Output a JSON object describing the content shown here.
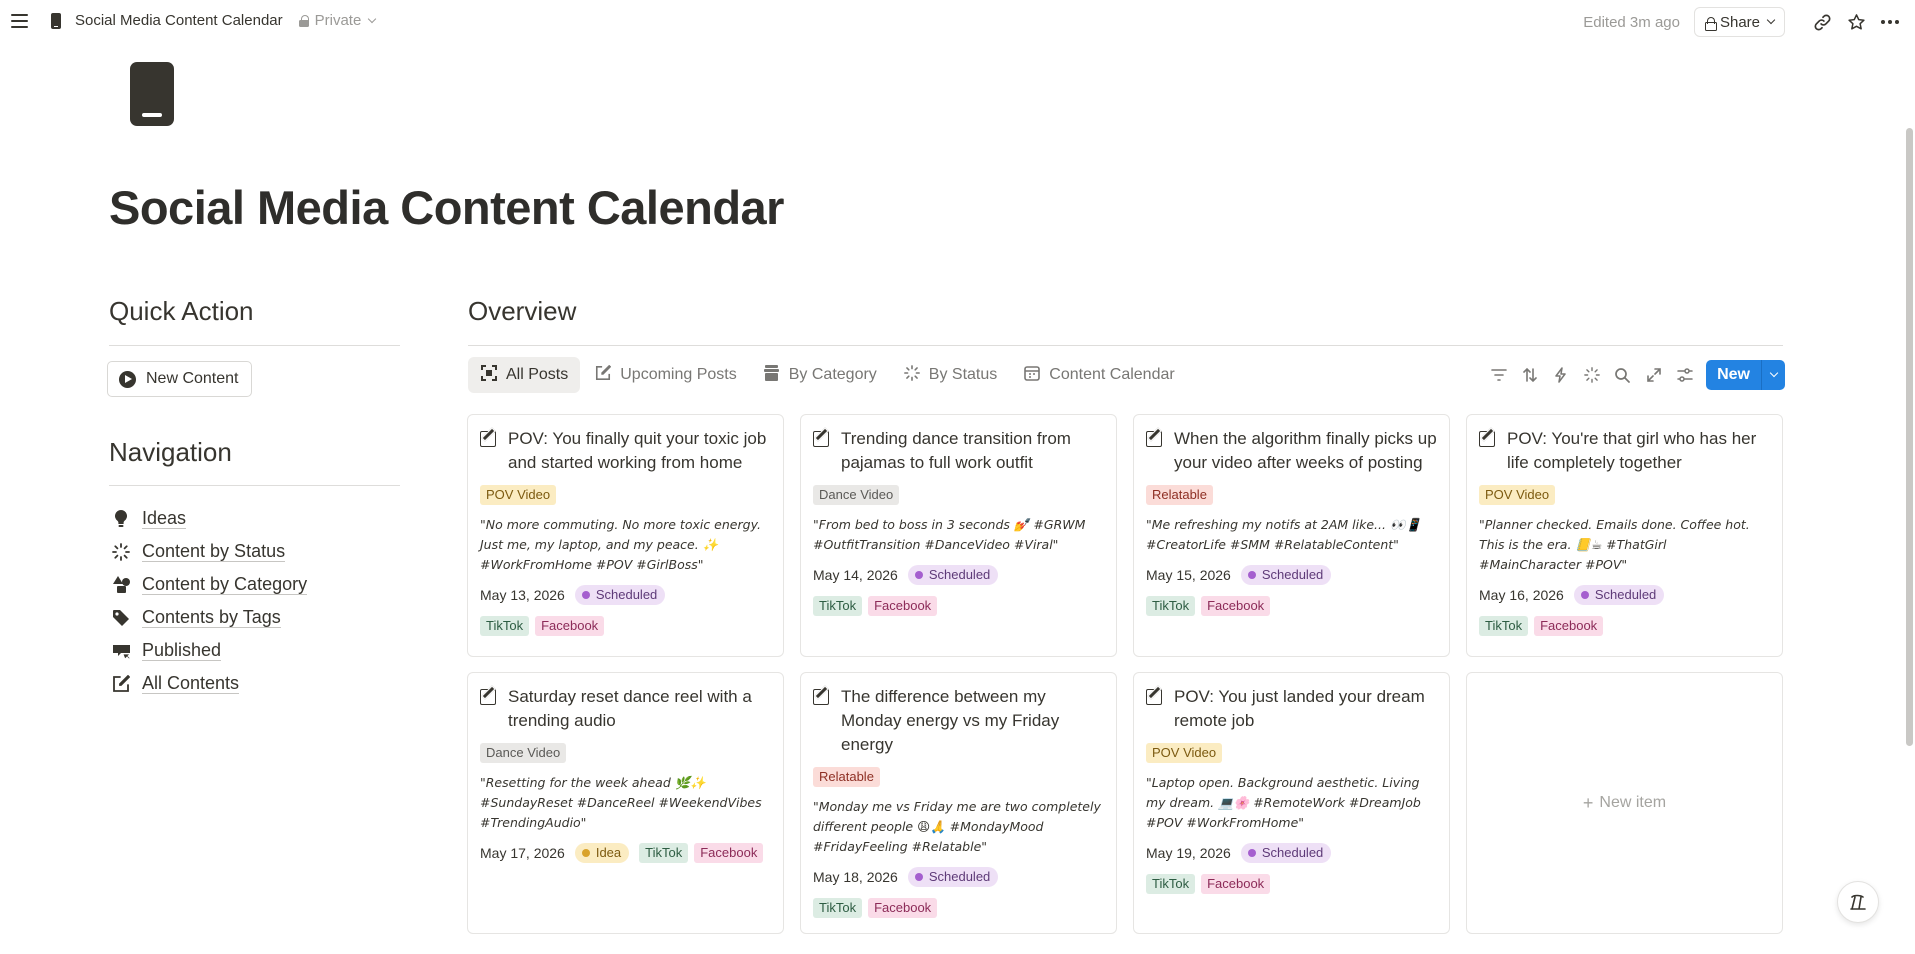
{
  "topbar": {
    "page_name": "Social Media Content Calendar",
    "visibility": "Private",
    "edited": "Edited 3m ago",
    "share_label": "Share"
  },
  "page": {
    "title": "Social Media Content Calendar"
  },
  "quick_action": {
    "heading": "Quick Action",
    "new_content_label": "New Content"
  },
  "navigation": {
    "heading": "Navigation",
    "items": [
      {
        "label": "Ideas",
        "icon": "lightbulb-icon"
      },
      {
        "label": "Content by Status",
        "icon": "loader-icon"
      },
      {
        "label": "Content by Category",
        "icon": "shapes-icon"
      },
      {
        "label": "Contents by Tags",
        "icon": "tag-icon"
      },
      {
        "label": "Published",
        "icon": "megaphone-icon"
      },
      {
        "label": "All Contents",
        "icon": "edit-icon"
      }
    ]
  },
  "overview": {
    "heading": "Overview",
    "tabs": [
      {
        "label": "All Posts",
        "icon": "expand-icon",
        "active": true
      },
      {
        "label": "Upcoming Posts",
        "icon": "edit-icon",
        "active": false
      },
      {
        "label": "By Category",
        "icon": "archive-icon",
        "active": false
      },
      {
        "label": "By Status",
        "icon": "loader-icon",
        "active": false
      },
      {
        "label": "Content Calendar",
        "icon": "calendar-icon",
        "active": false
      }
    ],
    "new_label": "New",
    "new_item_label": "New item"
  },
  "colors": {
    "accent": "#2383e2",
    "pov_video_bg": "#fbecc2",
    "pov_video_fg": "#7c5a10",
    "dance_video_bg": "#e9e8e6",
    "dance_video_fg": "#5b5a57",
    "relatable_bg": "#fbdcd8",
    "relatable_fg": "#8e2f24",
    "scheduled_bg": "#eee0f6",
    "scheduled_dot": "#a55fcf",
    "scheduled_fg": "#5e3a78",
    "idea_bg": "#fbecc2",
    "idea_dot": "#d9a22a",
    "idea_fg": "#7c5a10",
    "tiktok_bg": "#dcece3",
    "tiktok_fg": "#2e5d43",
    "facebook_bg": "#fadbe8",
    "facebook_fg": "#8c2b58"
  },
  "cards": [
    {
      "title": "POV: You finally quit your toxic job and started working from home",
      "category": "POV Video",
      "quote": "\"No more commuting. No more toxic energy. Just me, my laptop, and my peace. ✨ #WorkFromHome #POV #GirlBoss\"",
      "date": "May 13, 2026",
      "status": "Scheduled",
      "platforms": [
        "TikTok",
        "Facebook"
      ]
    },
    {
      "title": "Trending dance transition from pajamas to full work outfit",
      "category": "Dance Video",
      "quote": "\"From bed to boss in 3 seconds 💅 #GRWM #OutfitTransition #DanceVideo #Viral\"",
      "date": "May 14, 2026",
      "status": "Scheduled",
      "platforms": [
        "TikTok",
        "Facebook"
      ]
    },
    {
      "title": "When the algorithm finally picks up your video after weeks of posting",
      "category": "Relatable",
      "quote": "\"Me refreshing my notifs at 2AM like... 👀📱 #CreatorLife #SMM #RelatableContent\"",
      "date": "May 15, 2026",
      "status": "Scheduled",
      "platforms": [
        "TikTok",
        "Facebook"
      ]
    },
    {
      "title": "POV: You're that girl who has her life completely together",
      "category": "POV Video",
      "quote": "\"Planner checked. Emails done. Coffee hot. This is the era. 📒☕ #ThatGirl #MainCharacter #POV\"",
      "date": "May 16, 2026",
      "status": "Scheduled",
      "platforms": [
        "TikTok",
        "Facebook"
      ]
    },
    {
      "title": "Saturday reset dance reel with a trending audio",
      "category": "Dance Video",
      "quote": "\"Resetting for the week ahead 🌿✨ #SundayReset #DanceReel #WeekendVibes #TrendingAudio\"",
      "date": "May 17, 2026",
      "status": "Idea",
      "platforms": [
        "TikTok",
        "Facebook"
      ]
    },
    {
      "title": "The difference between my Monday energy vs my Friday energy",
      "category": "Relatable",
      "quote": "\"Monday me vs Friday me are two completely different people 😩🙏 #MondayMood #FridayFeeling #Relatable\"",
      "date": "May 18, 2026",
      "status": "Scheduled",
      "platforms": [
        "TikTok",
        "Facebook"
      ]
    },
    {
      "title": "POV: You just landed your dream remote job",
      "category": "POV Video",
      "quote": "\"Laptop open. Background aesthetic. Living my dream. 💻🌸 #RemoteWork #DreamJob #POV #WorkFromHome\"",
      "date": "May 19, 2026",
      "status": "Scheduled",
      "platforms": [
        "TikTok",
        "Facebook"
      ]
    }
  ]
}
